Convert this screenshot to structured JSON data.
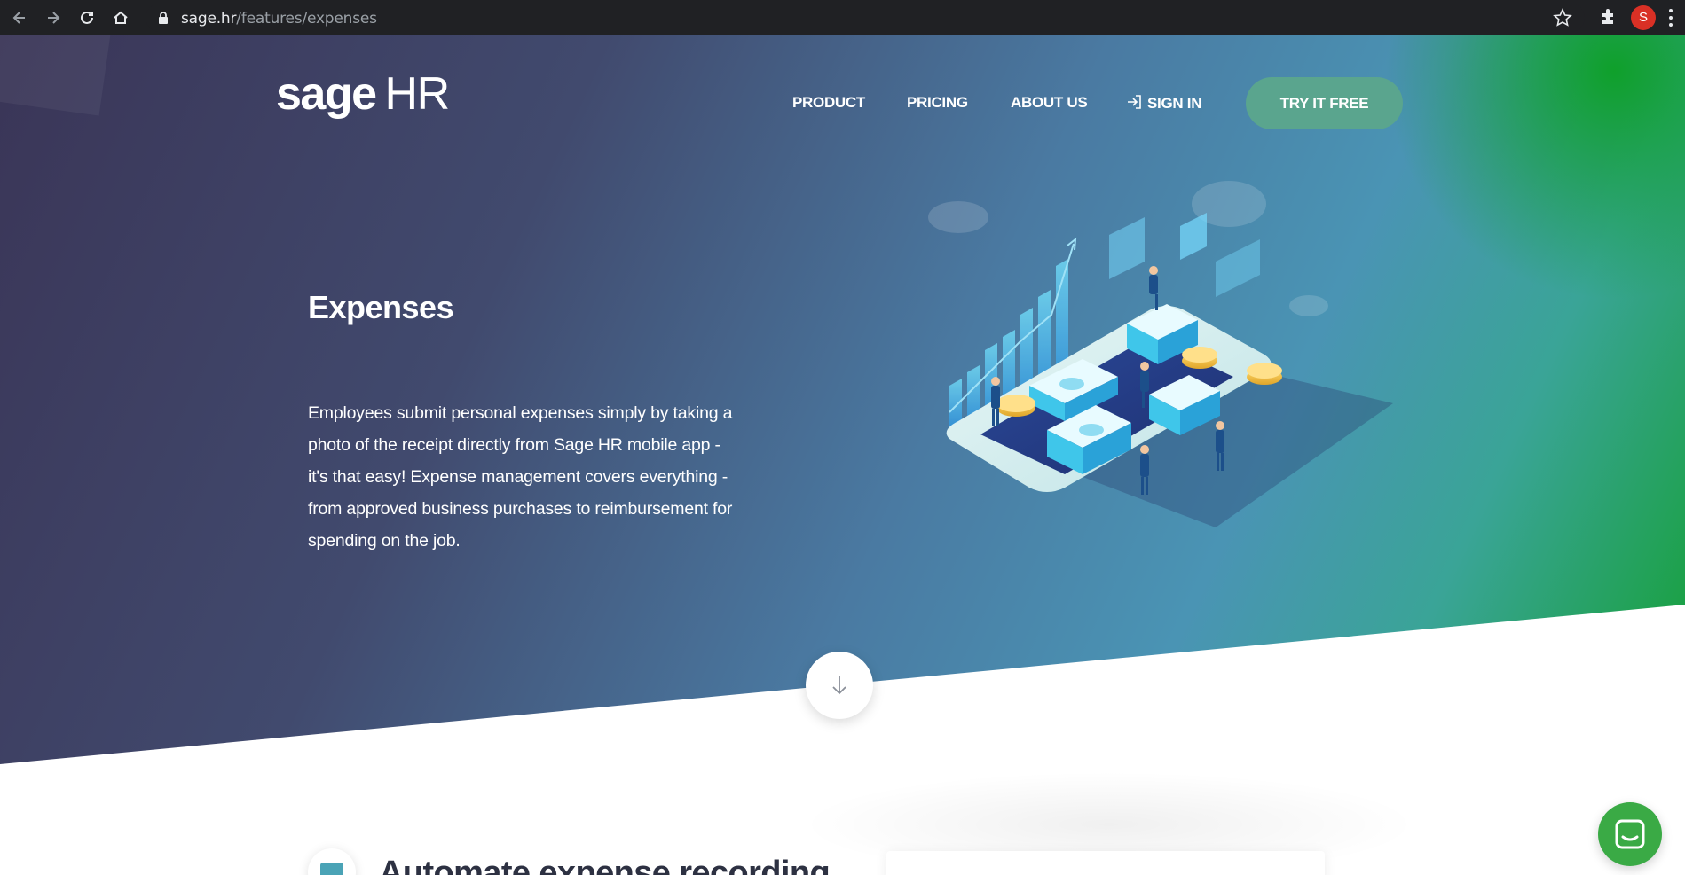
{
  "browser": {
    "url_domain": "sage.hr",
    "url_path": "/features/expenses",
    "profile_initial": "S",
    "icons": [
      "back-icon",
      "forward-icon",
      "reload-icon",
      "home-icon",
      "lock-icon",
      "star-icon",
      "extensions-icon",
      "menu-icon"
    ]
  },
  "header": {
    "logo_brand": "sage",
    "logo_suffix": "HR",
    "nav": {
      "product": "PRODUCT",
      "pricing": "PRICING",
      "about": "ABOUT US",
      "sign_in": "SIGN IN"
    },
    "cta": "TRY IT FREE"
  },
  "hero": {
    "title": "Expenses",
    "description": "Employees submit personal expenses simply by taking a photo of the receipt directly from Sage HR mobile app - it's that easy! Expense management covers everything - from approved business purchases to reimbursement for spending on the job."
  },
  "section": {
    "title": "Automate expense recording"
  },
  "colors": {
    "gradient_start": "#3a3557",
    "gradient_mid": "#4a94b4",
    "gradient_end": "#13a030",
    "cta_bg": "#5aa58e",
    "chat_bg": "#3aaa45",
    "accent_teal": "#4aa3b6"
  }
}
